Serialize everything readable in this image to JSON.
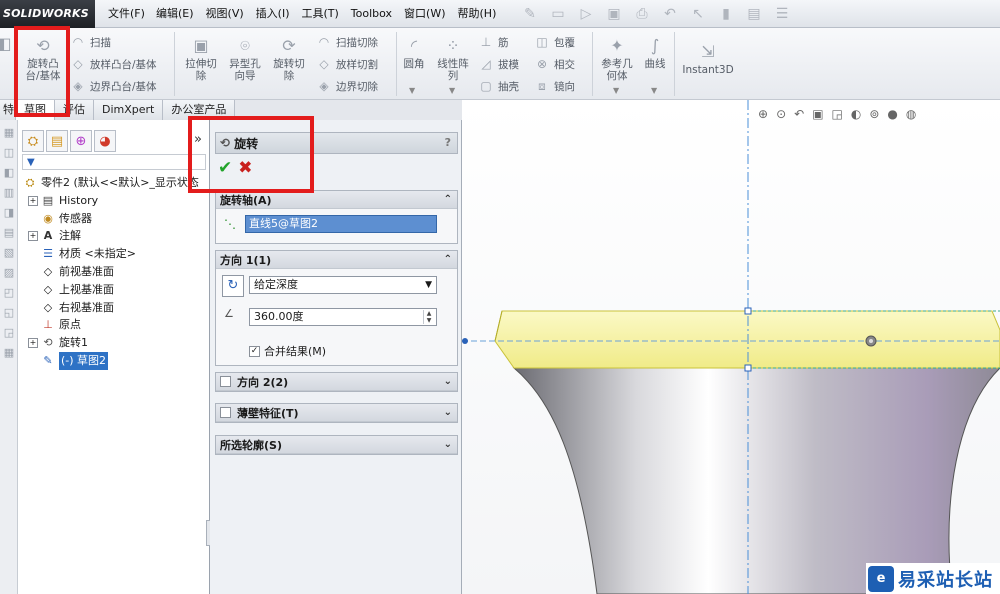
{
  "app": {
    "logo_text": "SOLIDWORKS"
  },
  "menu": {
    "items": [
      "文件(F)",
      "编辑(E)",
      "视图(V)",
      "插入(I)",
      "工具(T)",
      "Toolbox",
      "窗口(W)",
      "帮助(H)"
    ]
  },
  "quick_access_icons": [
    "pin-icon",
    "new-icon",
    "open-icon",
    "save-icon",
    "print-icon",
    "undo-icon",
    "select-icon",
    "rebuild-icon",
    "options-icon",
    "help-icon"
  ],
  "ribbon": {
    "revolve_boss": {
      "line1": "旋转凸",
      "line2": "台/基体"
    },
    "sweep": "扫描",
    "loft_boss": "放样凸台/基体",
    "boundary_boss": "边界凸台/基体",
    "extrude_cut": {
      "line1": "拉伸切",
      "line2": "除"
    },
    "hole_wizard": {
      "line1": "异型孔",
      "line2": "向导"
    },
    "revolve_cut": {
      "line1": "旋转切",
      "line2": "除"
    },
    "swept_cut": "扫描切除",
    "lofted_cut": "放样切割",
    "boundary_cut": "边界切除",
    "fillet": "圆角",
    "linear_pattern": {
      "line1": "线性阵",
      "line2": "列"
    },
    "rib": "筋",
    "draft": "拔模",
    "shell": "抽壳",
    "wrap": "包覆",
    "intersect": "相交",
    "mirror": "镜向",
    "ref_geometry": {
      "line1": "参考几",
      "line2": "何体"
    },
    "curves": "曲线",
    "instant3d": "Instant3D"
  },
  "command_tabs": [
    "特征",
    "草图",
    "评估",
    "DimXpert",
    "办公室产品"
  ],
  "tree": {
    "root": "零件2 (默认<<默认>_显示状态",
    "items": [
      {
        "label": "History",
        "icon": "history-icon",
        "expandable": true
      },
      {
        "label": "传感器",
        "icon": "sensor-icon",
        "expandable": false
      },
      {
        "label": "注解",
        "icon": "annotation-icon",
        "expandable": true
      },
      {
        "label": "材质 <未指定>",
        "icon": "material-icon",
        "expandable": false
      },
      {
        "label": "前视基准面",
        "icon": "plane-icon",
        "expandable": false
      },
      {
        "label": "上视基准面",
        "icon": "plane-icon",
        "expandable": false
      },
      {
        "label": "右视基准面",
        "icon": "plane-icon",
        "expandable": false
      },
      {
        "label": "原点",
        "icon": "origin-icon",
        "expandable": false
      },
      {
        "label": "旋转1",
        "icon": "revolve-icon",
        "expandable": true
      },
      {
        "label": "(-) 草图2",
        "icon": "sketch-icon",
        "expandable": false,
        "selected": true
      }
    ]
  },
  "property_manager": {
    "title": "旋转",
    "help": "?",
    "axis_section": {
      "title": "旋转轴(A)",
      "value": "直线5@草图2"
    },
    "dir1_section": {
      "title": "方向 1(1)",
      "end_condition": "给定深度",
      "angle": "360.00度",
      "merge_label": "合并结果(M)",
      "merge_checked": true
    },
    "dir2_section": {
      "title": "方向 2(2)"
    },
    "thin_section": {
      "title": "薄壁特征(T)"
    },
    "contours_section": {
      "title": "所选轮廓(S)"
    }
  },
  "watermark": {
    "text": "易采站长站"
  },
  "colors": {
    "highlight": "#e31c1c",
    "accent": "#2e72c5",
    "part": "#f3f09a"
  }
}
